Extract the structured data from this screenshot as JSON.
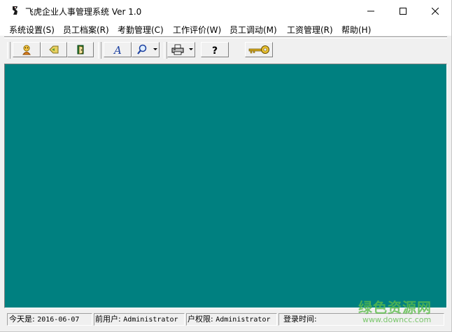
{
  "window": {
    "title": "飞虎企业人事管理系统 Ver 1.0"
  },
  "menu": {
    "items": [
      {
        "label": "系统设置(S)"
      },
      {
        "label": "员工档案(R)"
      },
      {
        "label": "考勤管理(C)"
      },
      {
        "label": "工作评价(W)"
      },
      {
        "label": "员工调动(M)"
      },
      {
        "label": "工资管理(R)"
      },
      {
        "label": "帮助(H)"
      }
    ]
  },
  "toolbar": {
    "buttons": [
      {
        "icon": "user-icon"
      },
      {
        "icon": "tag-icon"
      },
      {
        "icon": "door-exit-icon"
      },
      {
        "icon": "font-icon"
      },
      {
        "icon": "search-icon",
        "has_dropdown": true
      },
      {
        "icon": "printer-icon",
        "has_dropdown": true
      },
      {
        "icon": "help-icon"
      },
      {
        "icon": "key-icon"
      }
    ]
  },
  "workspace": {
    "background": "#008080"
  },
  "status": {
    "today_label": "今天是:",
    "today_value": "2016-06-07",
    "user_label": "当前用户:",
    "user_value": "Administrator",
    "permission_label": "用户权限:",
    "permission_value": "Administrator",
    "login_label": "登录时间:"
  },
  "watermark": {
    "big": "绿色资源网",
    "small": "www.downcc.com"
  }
}
